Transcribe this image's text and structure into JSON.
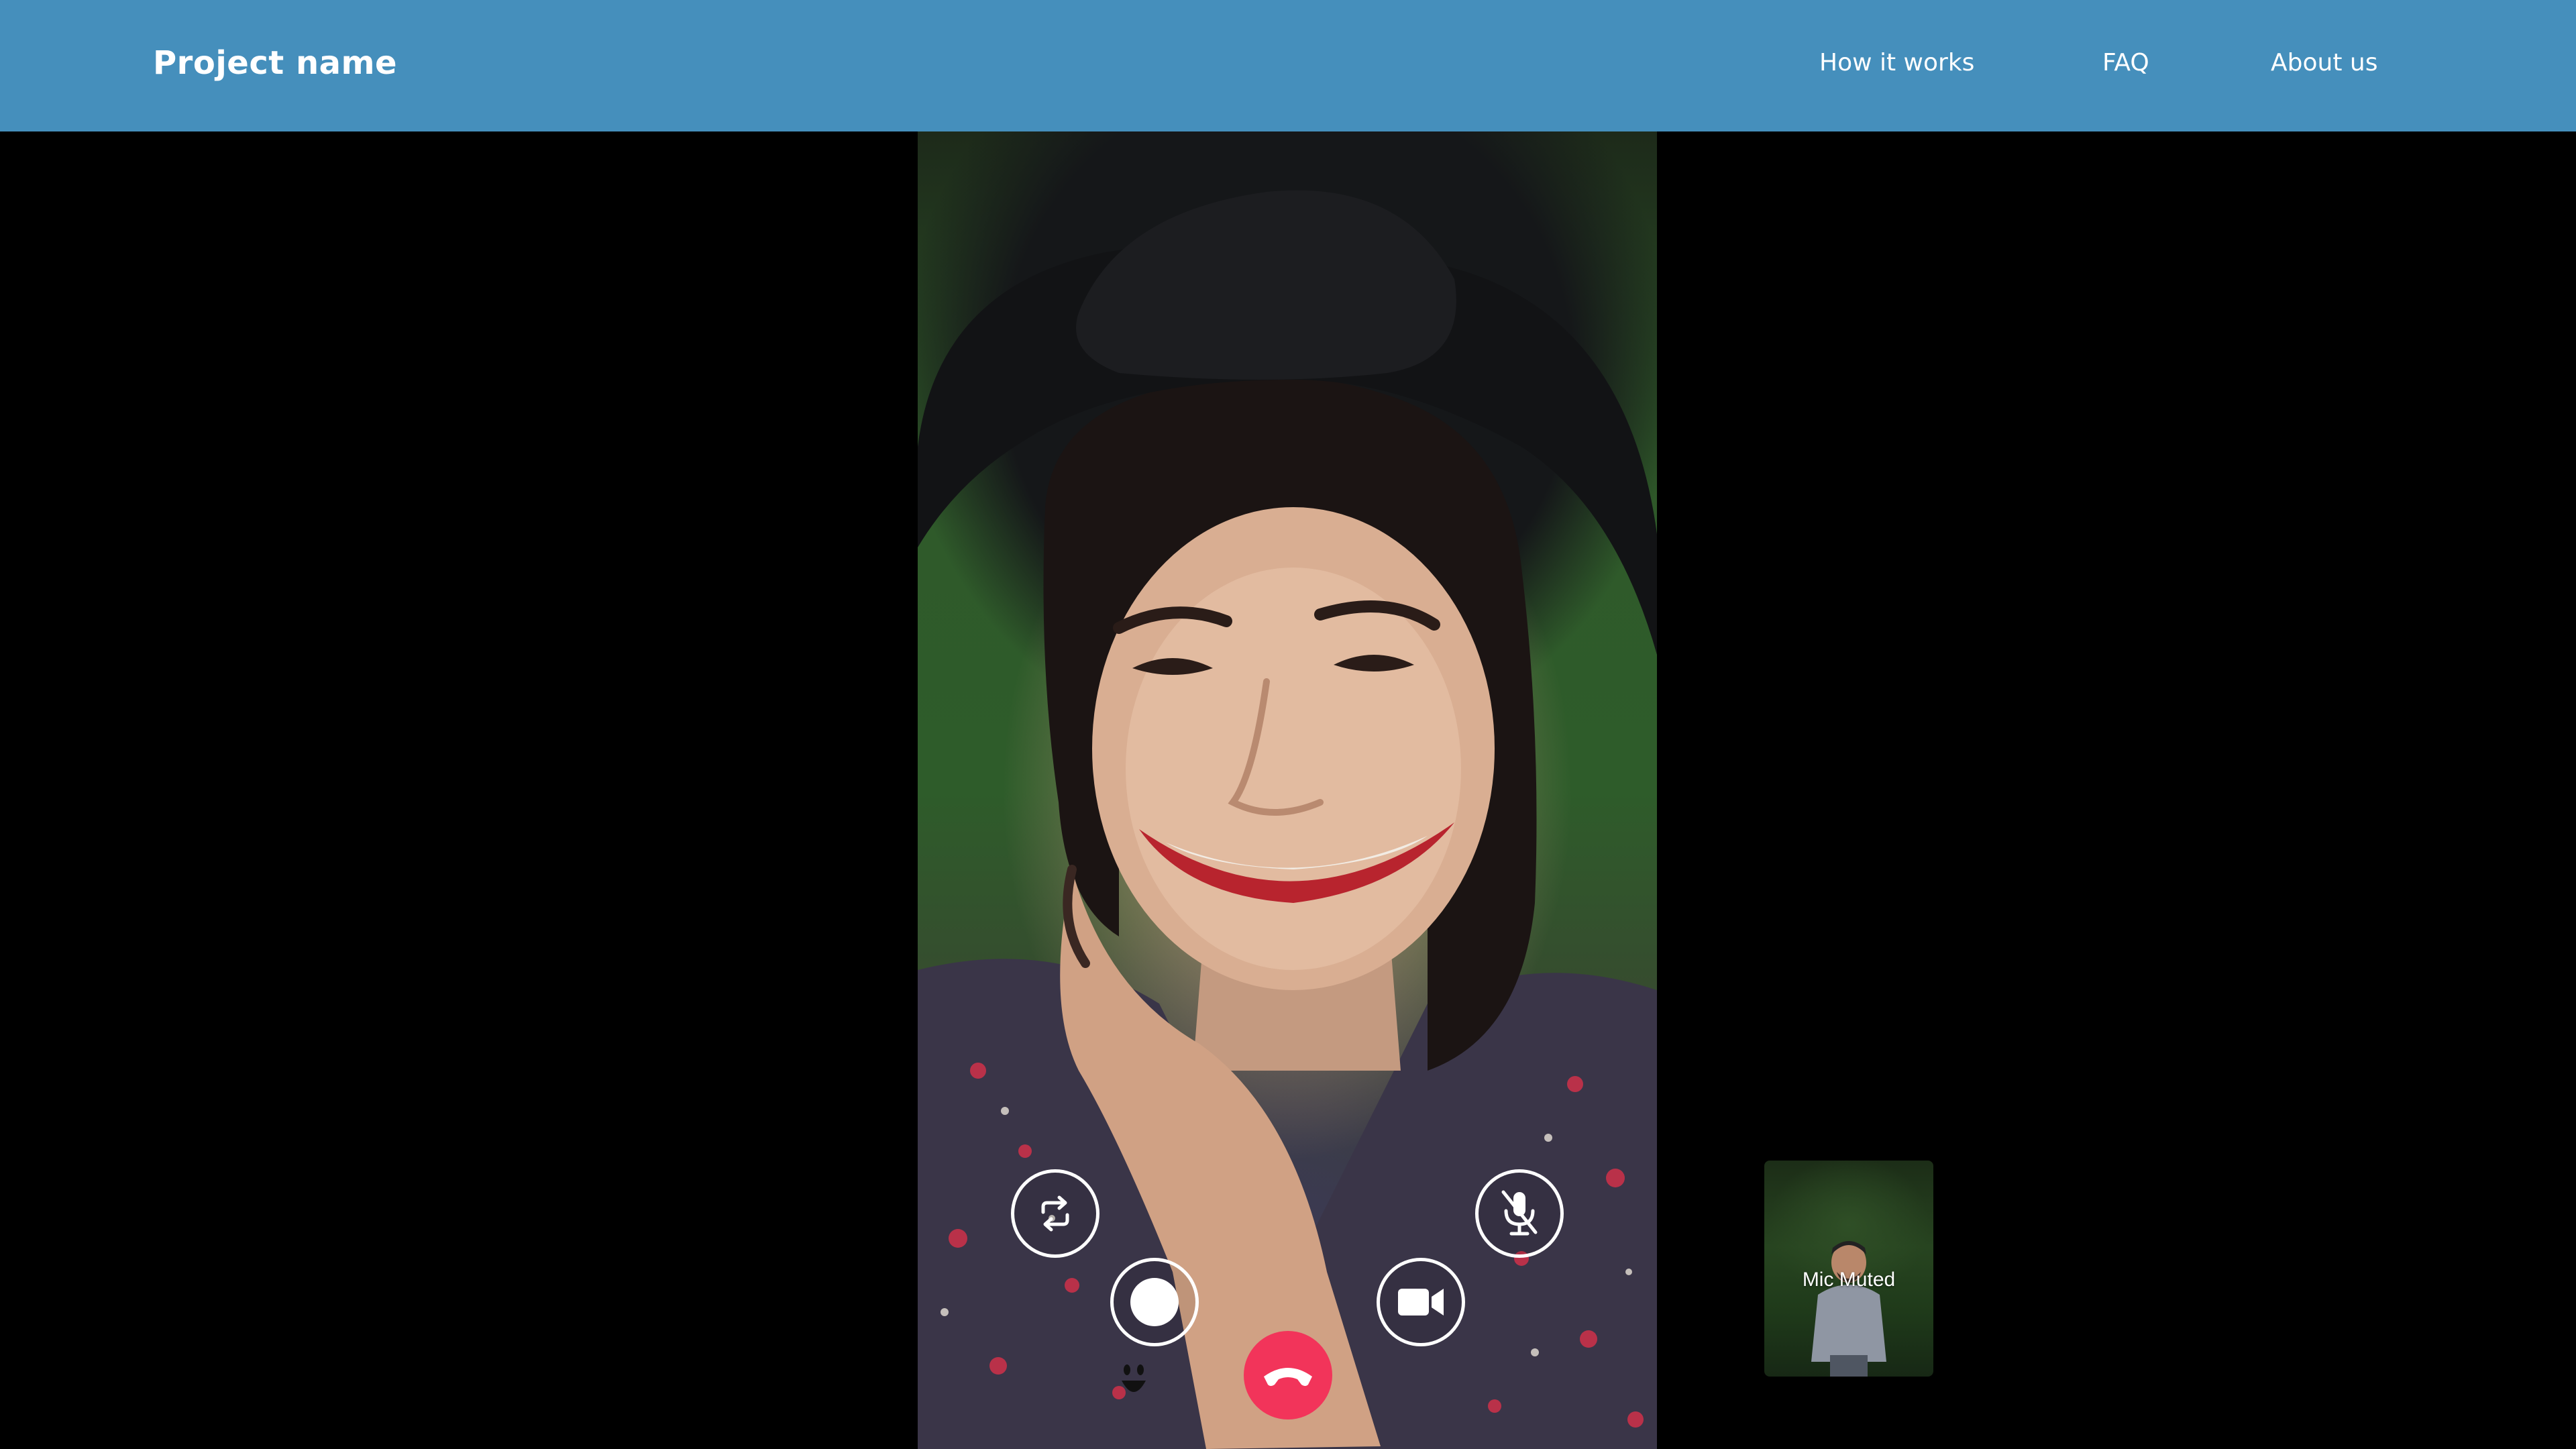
{
  "navbar": {
    "brand": "Project name",
    "links": [
      "How it works",
      "FAQ",
      "About us"
    ],
    "background": "#458fbc"
  },
  "call": {
    "remote_video": {
      "content": "remote participant camera feed"
    },
    "controls": {
      "flip_camera_icon": "flip-camera-icon",
      "record_icon": "record-icon",
      "video_toggle_icon": "video-camera-icon",
      "mic_toggle_icon": "mic-off-icon",
      "end_call_icon": "phone-hangup-icon",
      "emoji_icon": "smiley-icon",
      "end_call_color": "#f2345a"
    },
    "self_preview": {
      "status_label": "Mic Muted"
    }
  }
}
